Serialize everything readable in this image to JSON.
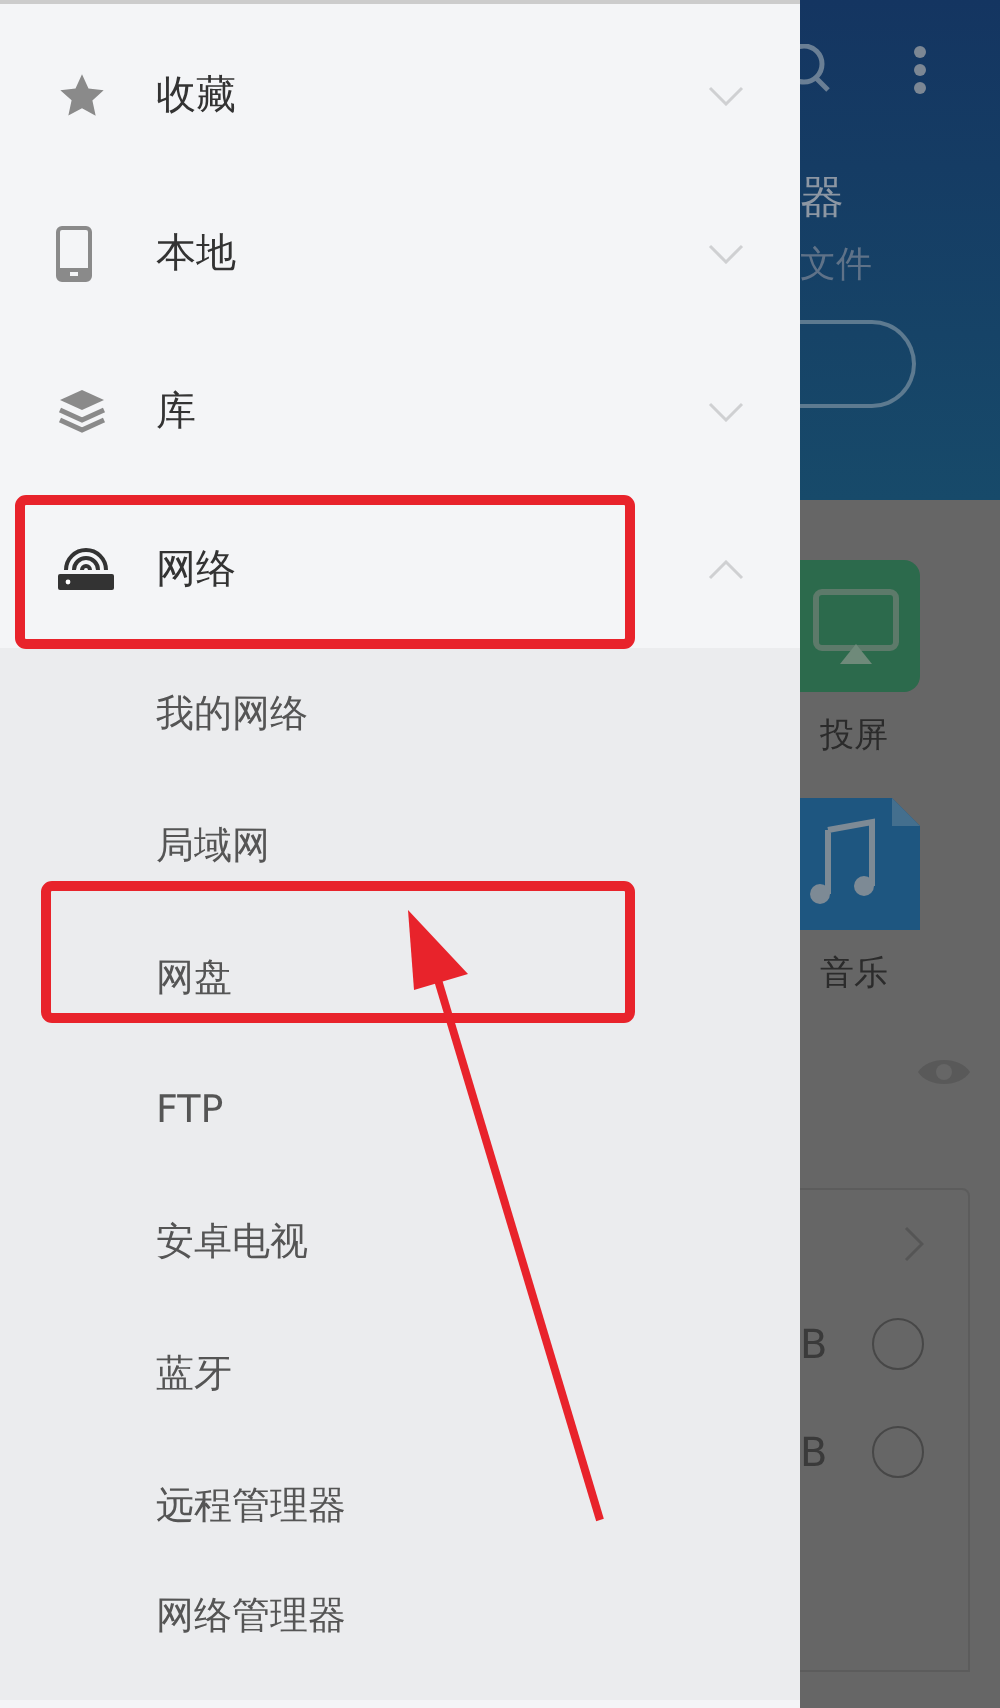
{
  "drawer": {
    "sections": [
      {
        "label": "收藏",
        "kind": "star",
        "expanded": false
      },
      {
        "label": "本地",
        "kind": "phone",
        "expanded": false
      },
      {
        "label": "库",
        "kind": "layers",
        "expanded": false
      },
      {
        "label": "网络",
        "kind": "router",
        "expanded": true,
        "children": [
          {
            "label": "我的网络"
          },
          {
            "label": "局域网"
          },
          {
            "label": "网盘"
          },
          {
            "label": "FTP"
          },
          {
            "label": "安卓电视"
          },
          {
            "label": "蓝牙"
          },
          {
            "label": "远程管理器"
          },
          {
            "label": "网络管理器"
          }
        ]
      }
    ]
  },
  "background_app": {
    "header": {
      "title": "器",
      "subtitle": "文件"
    },
    "tiles": [
      {
        "label": "投屏",
        "kind": "cast"
      },
      {
        "label": "音乐",
        "kind": "music"
      }
    ],
    "rows": [
      {
        "size": "B",
        "selected": false
      },
      {
        "size": "B",
        "selected": false
      }
    ]
  }
}
